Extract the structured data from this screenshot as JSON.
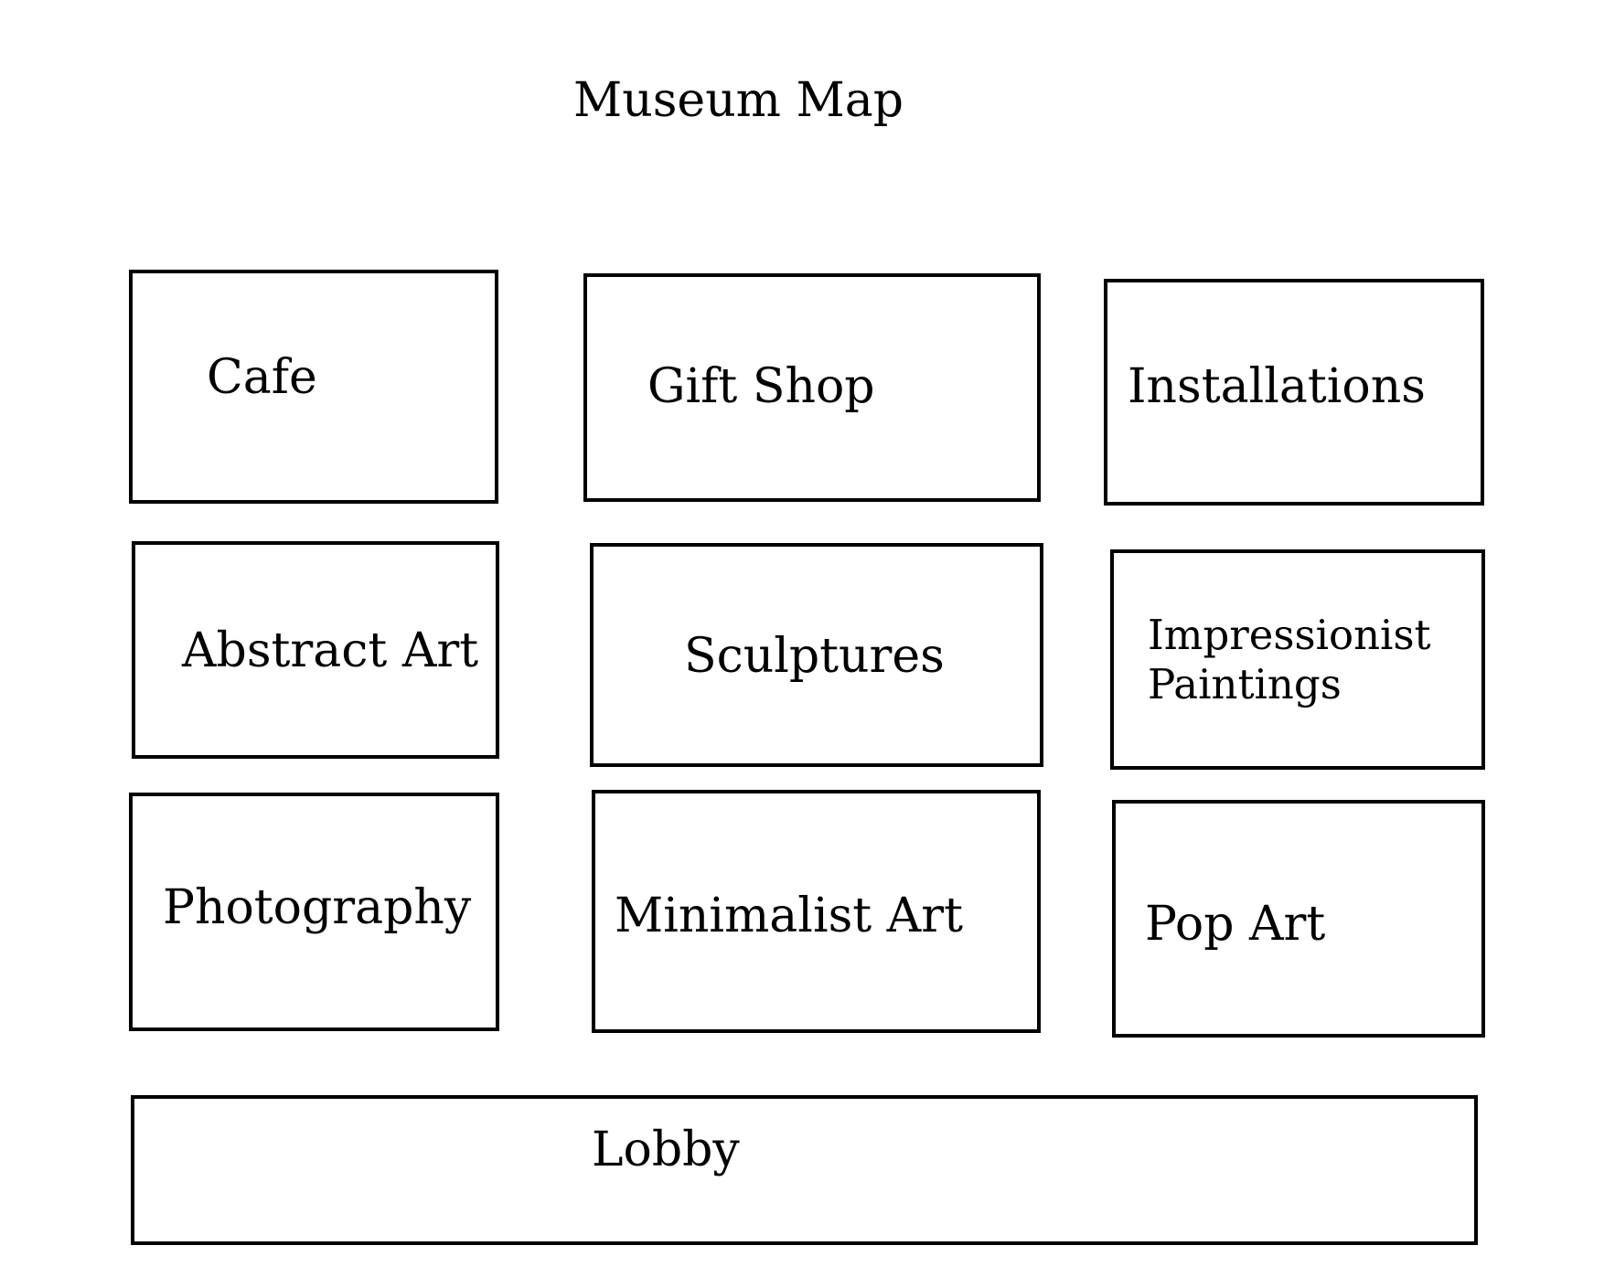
{
  "map": {
    "title": "Museum Map",
    "rooms": {
      "cafe": "Cafe",
      "gift_shop": "Gift Shop",
      "installations": "Installations",
      "abstract_art": "Abstract Art",
      "sculptures": "Sculptures",
      "impressionist_paintings": "Impressionist Paintings",
      "photography": "Photography",
      "minimalist_art": "Minimalist Art",
      "pop_art": "Pop Art",
      "lobby": "Lobby"
    }
  }
}
